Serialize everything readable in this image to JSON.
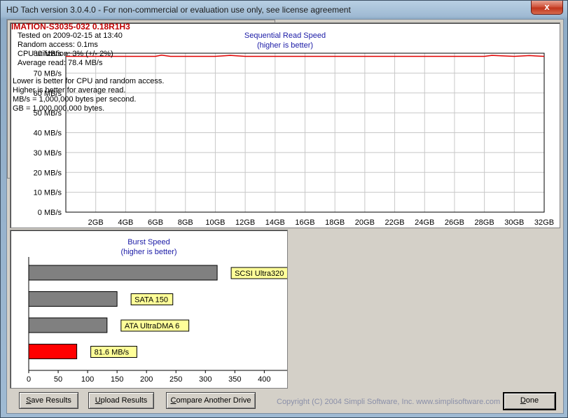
{
  "window": {
    "title": "HD Tach version 3.0.4.0  - For non-commercial or evaluation use only, see license agreement",
    "close_glyph": "x"
  },
  "sequential": {
    "title": "Sequential Read Speed",
    "subtitle": "(higher is better)"
  },
  "burst": {
    "title": "Burst Speed",
    "subtitle": "(higher is better)"
  },
  "info": {
    "drive_name": "IMATION-S3035-032 0.18R1H3",
    "tested_on": "Tested on 2009-02-15 at 13:40",
    "random_access": "Random access: 0.1ms",
    "cpu_util": "CPU utilization: 3% (+/- 2%)",
    "avg_read": "Average read: 78.4 MB/s",
    "notes": [
      "Lower is better for CPU and random access.",
      "Higher is better for average read.",
      "MB/s = 1,000,000 bytes per second.",
      "GB = 1,000,000,000 bytes."
    ]
  },
  "buttons": {
    "save_mn": "S",
    "save_rest": "ave Results",
    "upload_mn": "U",
    "upload_rest": "pload Results",
    "compare_mn": "C",
    "compare_rest": "ompare Another Drive",
    "done_mn": "D",
    "done_rest": "one"
  },
  "copyright": "Copyright (C) 2004 Simpli Software, Inc. www.simplisoftware.com",
  "colors": {
    "line": "#e00000",
    "bar_gray": "#808080",
    "bar_red": "#ff0000",
    "label_bg": "#ffff99",
    "title_blue": "#1a1aa6"
  },
  "chart_data": [
    {
      "type": "line",
      "title": "Sequential Read Speed",
      "subtitle": "(higher is better)",
      "y_ticks": [
        "0 MB/s",
        "10 MB/s",
        "20 MB/s",
        "30 MB/s",
        "40 MB/s",
        "50 MB/s",
        "60 MB/s",
        "70 MB/s",
        "80 MB/s"
      ],
      "x_ticks": [
        "2GB",
        "4GB",
        "6GB",
        "8GB",
        "10GB",
        "12GB",
        "14GB",
        "16GB",
        "18GB",
        "20GB",
        "22GB",
        "24GB",
        "26GB",
        "28GB",
        "30GB",
        "32GB"
      ],
      "ylim": [
        0,
        80
      ],
      "xlim": [
        0,
        32
      ],
      "grid": true,
      "series": [
        {
          "x": [
            0,
            2,
            4,
            6,
            6.4,
            7,
            8,
            10,
            11,
            12,
            14,
            16,
            18,
            20,
            22,
            24,
            26,
            28,
            28.5,
            30,
            31,
            32
          ],
          "y": [
            78.4,
            78.4,
            78.4,
            78.4,
            79.0,
            78.4,
            78.4,
            78.4,
            78.9,
            78.4,
            78.4,
            78.4,
            78.4,
            78.4,
            78.4,
            78.4,
            78.4,
            78.4,
            78.9,
            78.4,
            78.8,
            78.4
          ]
        }
      ]
    },
    {
      "type": "bar",
      "orientation": "horizontal",
      "title": "Burst Speed",
      "subtitle": "(higher is better)",
      "x_ticks": [
        "0",
        "50",
        "100",
        "150",
        "200",
        "250",
        "300",
        "350",
        "400"
      ],
      "xlim": [
        0,
        440
      ],
      "bars": [
        {
          "label": "SCSI Ultra320",
          "value": 320,
          "color": "#808080"
        },
        {
          "label": "SATA 150",
          "value": 150,
          "color": "#808080"
        },
        {
          "label": "ATA UltraDMA 6",
          "value": 133,
          "color": "#808080"
        },
        {
          "label": "81.6 MB/s",
          "value": 81.6,
          "color": "#ff0000"
        }
      ]
    }
  ]
}
